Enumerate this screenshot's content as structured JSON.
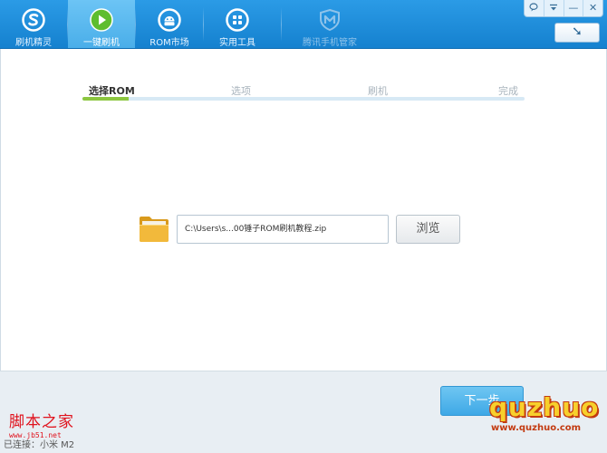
{
  "nav": {
    "tabs": [
      {
        "label": "刷机精灵",
        "icon": "shuaji-logo-icon"
      },
      {
        "label": "一键刷机",
        "icon": "play-arrow-icon"
      },
      {
        "label": "ROM市场",
        "icon": "android-icon"
      },
      {
        "label": "实用工具",
        "icon": "grid-tools-icon"
      },
      {
        "label": "腾讯手机管家",
        "icon": "tencent-shield-icon"
      }
    ],
    "active_index": 1
  },
  "window_controls": {
    "feedback_icon": "chat-bubble-icon",
    "menu_icon": "menu-dropdown-icon",
    "minimize": "—",
    "close": "✕"
  },
  "back_button": {
    "icon": "return-arrow-icon",
    "glyph": "➘"
  },
  "steps": {
    "labels": [
      "选择ROM",
      "选项",
      "刷机",
      "完成"
    ],
    "current": 0,
    "progress_percent": 10.5
  },
  "file_picker": {
    "path": "C:\\Users\\s...00锤子ROM刷机教程.zip",
    "browse_label": "浏览"
  },
  "footer": {
    "next_label": "下一步",
    "connection_status": "已连接：小米 M2"
  },
  "watermarks": {
    "jb51_title": "脚本之家",
    "jb51_url": "www.jb51.net",
    "quzhuo_name": "quzhuo",
    "quzhuo_url": "www.quzhuo.com"
  },
  "colors": {
    "topbar": "#1f8edb",
    "accent_green": "#8cc63f",
    "next_button": "#4fb3ec"
  }
}
